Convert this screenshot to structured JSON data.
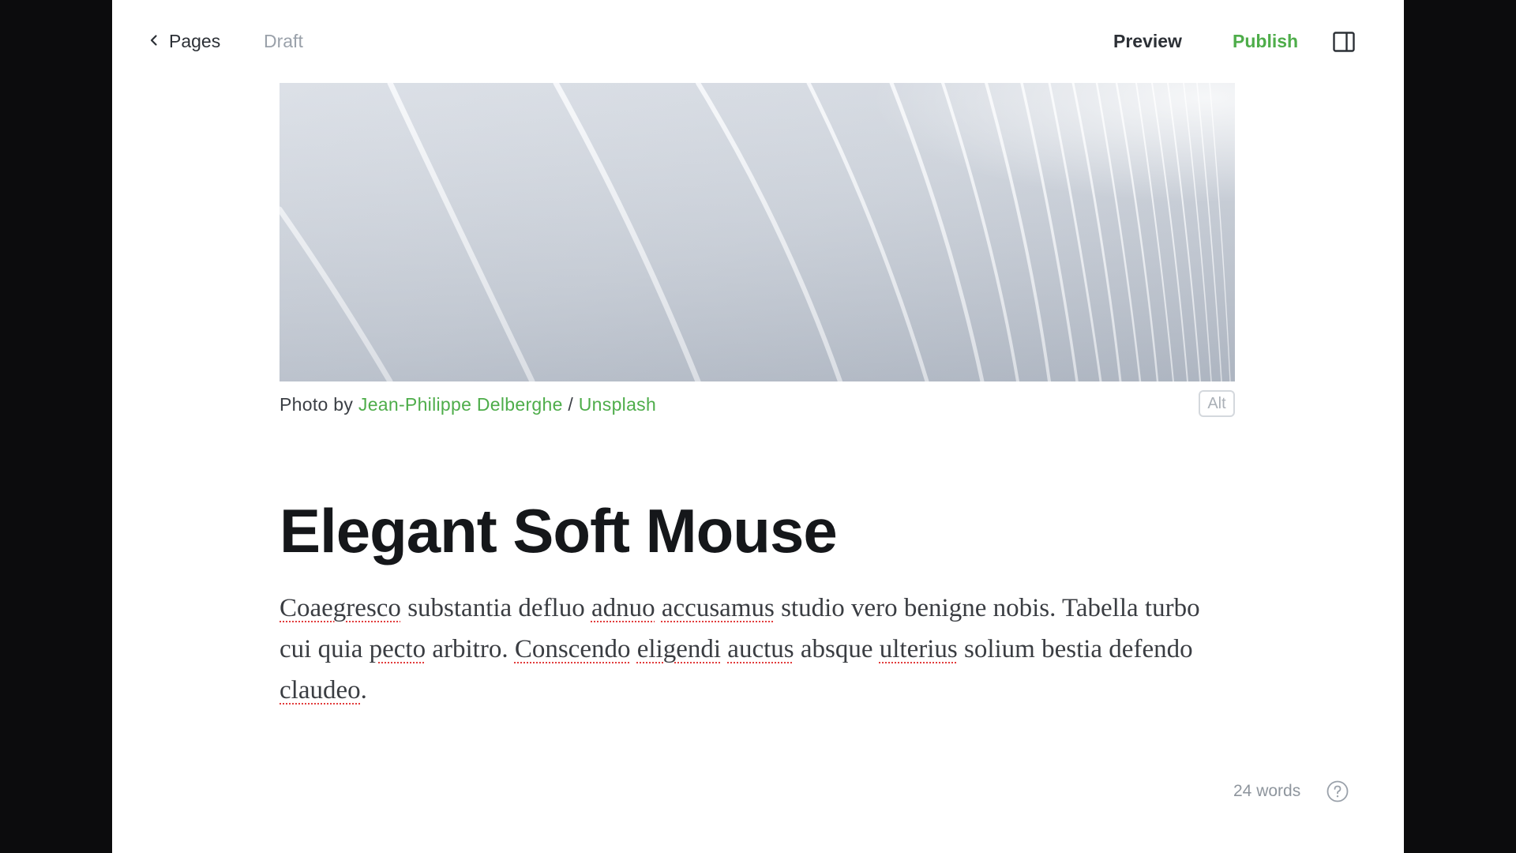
{
  "topbar": {
    "back_label": "Pages",
    "status": "Draft",
    "preview_label": "Preview",
    "publish_label": "Publish"
  },
  "feature_image": {
    "caption_prefix": "Photo by ",
    "author": "Jean-Philippe Delberghe",
    "separator": " / ",
    "source": "Unsplash",
    "alt_label": "Alt"
  },
  "post": {
    "title": "Elegant Soft Mouse",
    "body_words": [
      {
        "t": "Coaegresco",
        "sp": true
      },
      {
        "t": " substantia defluo "
      },
      {
        "t": "adnuo",
        "sp": true
      },
      {
        "t": " "
      },
      {
        "t": "accusamus",
        "sp": true
      },
      {
        "t": " studio vero benigne nobis. Tabella turbo cui quia "
      },
      {
        "t": "pecto",
        "sp": true
      },
      {
        "t": " arbitro. "
      },
      {
        "t": "Conscendo",
        "sp": true
      },
      {
        "t": " "
      },
      {
        "t": "eligendi",
        "sp": true
      },
      {
        "t": " "
      },
      {
        "t": "auctus",
        "sp": true
      },
      {
        "t": " absque "
      },
      {
        "t": "ulterius",
        "sp": true
      },
      {
        "t": " solium bestia defendo "
      },
      {
        "t": "claudeo",
        "sp": true
      },
      {
        "t": "."
      }
    ]
  },
  "footer": {
    "word_count": "24 words"
  },
  "colors": {
    "accent": "#4ead4a",
    "background": "#0c0c0d",
    "canvas": "#ffffff",
    "spellcheck": "#e23c3c"
  },
  "icons": {
    "back": "chevron-left-icon",
    "sidebar": "sidebar-toggle-icon",
    "help": "question-circle-icon"
  }
}
